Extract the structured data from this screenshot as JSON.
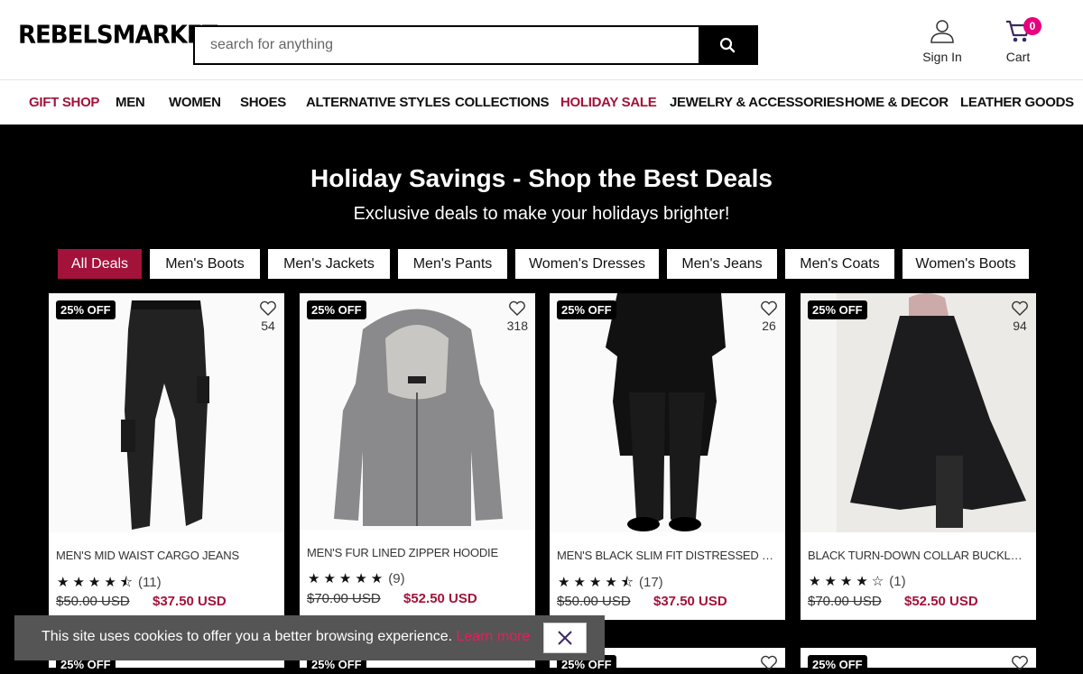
{
  "header": {
    "logo": "REBELSMARKET",
    "search_placeholder": "search for anything",
    "signin_label": "Sign In",
    "cart_label": "Cart",
    "cart_count": "0"
  },
  "nav": [
    "GIFT SHOP",
    "MEN",
    "WOMEN",
    "SHOES",
    "ALTERNATIVE STYLES",
    "COLLECTIONS",
    "HOLIDAY SALE",
    "JEWELRY & ACCESSORIES",
    "HOME & DECOR",
    "LEATHER GOODS"
  ],
  "hero": {
    "title": "Holiday Savings - Shop the Best Deals",
    "subtitle": "Exclusive deals to make your holidays brighter!"
  },
  "filters": [
    "All Deals",
    "Men's Boots",
    "Men's Jackets",
    "Men's Pants",
    "Women's Dresses",
    "Men's Jeans",
    "Men's Coats",
    "Women's Boots"
  ],
  "products": [
    {
      "badge": "25% OFF",
      "favs": "54",
      "title": "MEN'S MID WAIST CARGO JEANS",
      "stars": "★★★★⯪",
      "reviews": "(11)",
      "old_price": "$50.00 USD",
      "new_price": "$37.50 USD"
    },
    {
      "badge": "25% OFF",
      "favs": "318",
      "title": "MEN'S FUR LINED ZIPPER HOODIE",
      "stars": "★★★★★",
      "reviews": "(9)",
      "old_price": "$70.00 USD",
      "new_price": "$52.50 USD"
    },
    {
      "badge": "25% OFF",
      "favs": "26",
      "title": "MEN'S BLACK SLIM FIT DISTRESSED BIKER J...",
      "stars": "★★★★⯪",
      "reviews": "(17)",
      "old_price": "$50.00 USD",
      "new_price": "$37.50 USD"
    },
    {
      "badge": "25% OFF",
      "favs": "94",
      "title": "BLACK TURN-DOWN COLLAR BUCKLE STRAP ...",
      "stars": "★★★★☆",
      "reviews": "(1)",
      "old_price": "$70.00 USD",
      "new_price": "$52.50 USD"
    }
  ],
  "row2_badges": [
    "25% OFF",
    "25% OFF",
    "25% OFF",
    "25% OFF"
  ],
  "cookie": {
    "message": "This site uses cookies to offer you a better browsing experience. ",
    "learn_more": "Learn more"
  }
}
